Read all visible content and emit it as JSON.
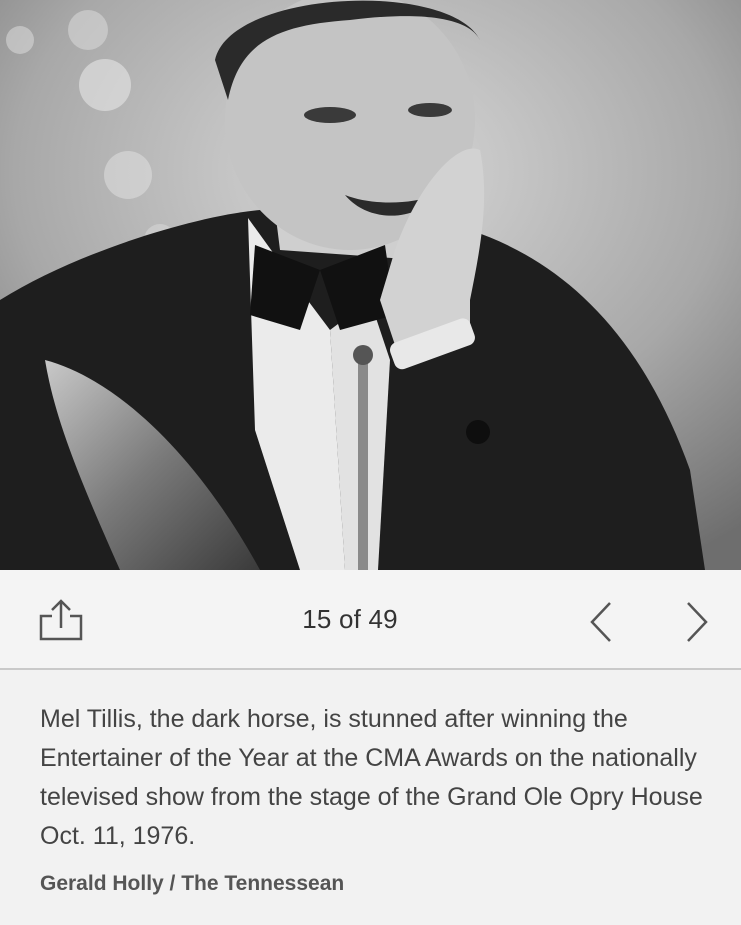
{
  "gallery": {
    "photo": {
      "description_icon": "photo-image"
    },
    "toolbar": {
      "share_icon": "share-icon",
      "counter": "15 of 49",
      "prev_icon": "chevron-left-icon",
      "next_icon": "chevron-right-icon"
    },
    "caption": {
      "text": "Mel Tillis, the dark horse, is stunned after winning the Entertainer of the Year at the CMA Awards on the nationally televised show from the stage of the Grand Ole Opry House Oct. 11, 1976.",
      "credit": "Gerald Holly / The Tennessean"
    }
  },
  "colors": {
    "background": "#f2f2f2",
    "toolbar_bg": "#f4f4f4",
    "divider": "#c9c9c9",
    "text": "#444444",
    "credit": "#555555",
    "icon": "#555555"
  }
}
